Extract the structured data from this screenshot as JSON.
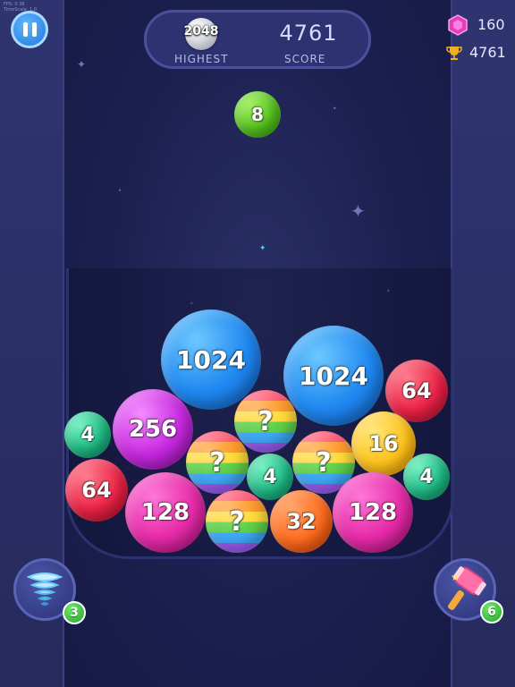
{
  "debug_text": [
    "FPS: 0.38",
    "TimeScale: 1.0"
  ],
  "score_panel": {
    "best_value": "2048",
    "best_label": "HIGHEST",
    "score_value": "4761",
    "score_label": "SCORE"
  },
  "currency": {
    "gems": "160",
    "trophies": "4761",
    "gem_icon": "pink-gem-icon",
    "trophy_icon": "gold-trophy-icon"
  },
  "next_ball": {
    "value": "8",
    "color": "green"
  },
  "balls": [
    {
      "value": "1024",
      "color": "blue"
    },
    {
      "value": "1024",
      "color": "blue"
    },
    {
      "value": "64",
      "color": "red"
    },
    {
      "value": "256",
      "color": "purple"
    },
    {
      "value": "?",
      "color": "rainbow"
    },
    {
      "value": "4",
      "color": "teal"
    },
    {
      "value": "16",
      "color": "yellow"
    },
    {
      "value": "?",
      "color": "rainbow"
    },
    {
      "value": "?",
      "color": "rainbow"
    },
    {
      "value": "4",
      "color": "teal"
    },
    {
      "value": "4",
      "color": "teal"
    },
    {
      "value": "64",
      "color": "red"
    },
    {
      "value": "128",
      "color": "magenta"
    },
    {
      "value": "?",
      "color": "rainbow"
    },
    {
      "value": "32",
      "color": "orange"
    },
    {
      "value": "128",
      "color": "magenta"
    }
  ],
  "powerups": {
    "tornado": {
      "count": "3",
      "icon": "tornado-icon"
    },
    "hammer": {
      "count": "6",
      "icon": "hammer-icon"
    }
  }
}
